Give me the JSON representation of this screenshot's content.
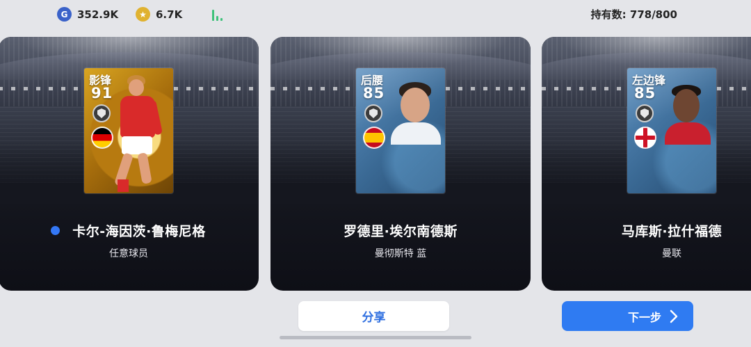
{
  "currency": {
    "gp_icon": "G",
    "gp": "352.9K",
    "coin_icon": "★",
    "coins": "6.7K",
    "signal_icon": "signal-bars-icon"
  },
  "holding": "持有数: 778/800",
  "players": [
    {
      "position": "影锋",
      "rating": "91",
      "name": "卡尔-海因茨·鲁梅尼格",
      "team": "任意球员",
      "card_style": "gold",
      "flag": "germany",
      "selected": true
    },
    {
      "position": "后腰",
      "rating": "85",
      "name": "罗德里·埃尔南德斯",
      "team": "曼彻斯特 蓝",
      "card_style": "blue",
      "flag": "spain",
      "selected": false
    },
    {
      "position": "左边锋",
      "rating": "85",
      "name": "马库斯·拉什福德",
      "team": "曼联",
      "card_style": "blue",
      "flag": "england",
      "selected": false
    }
  ],
  "buttons": {
    "share": "分享",
    "next": "下一步",
    "next_icon": "chevron-right-icon"
  },
  "colors": {
    "accent": "#2f7bf2",
    "selected_dot": "#3478f6"
  }
}
